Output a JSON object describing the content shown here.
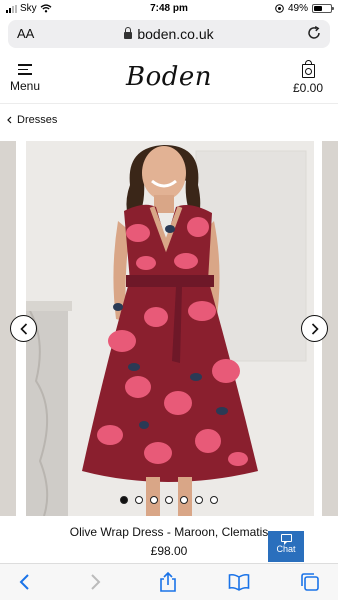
{
  "status_bar": {
    "carrier": "Sky",
    "time": "7:48 pm",
    "battery": "49%",
    "battery_level": 0.49
  },
  "browser": {
    "text_size_label": "AA",
    "url": "boden.co.uk",
    "reload_icon": "reload-icon"
  },
  "header": {
    "menu_label": "Menu",
    "logo": "Boden",
    "basket_total": "£0.00"
  },
  "breadcrumb": {
    "label": "Dresses"
  },
  "carousel": {
    "image_count": 7,
    "active_index": 0
  },
  "product": {
    "name": "Olive Wrap Dress - Maroon, Clematis",
    "price": "£98.00"
  },
  "chat": {
    "label": "Chat"
  },
  "colors": {
    "chat_bg": "#2a6fbd",
    "dress_base": "#8a1f2e",
    "dress_print": "#e85a78",
    "dress_accent": "#2a3a55"
  }
}
